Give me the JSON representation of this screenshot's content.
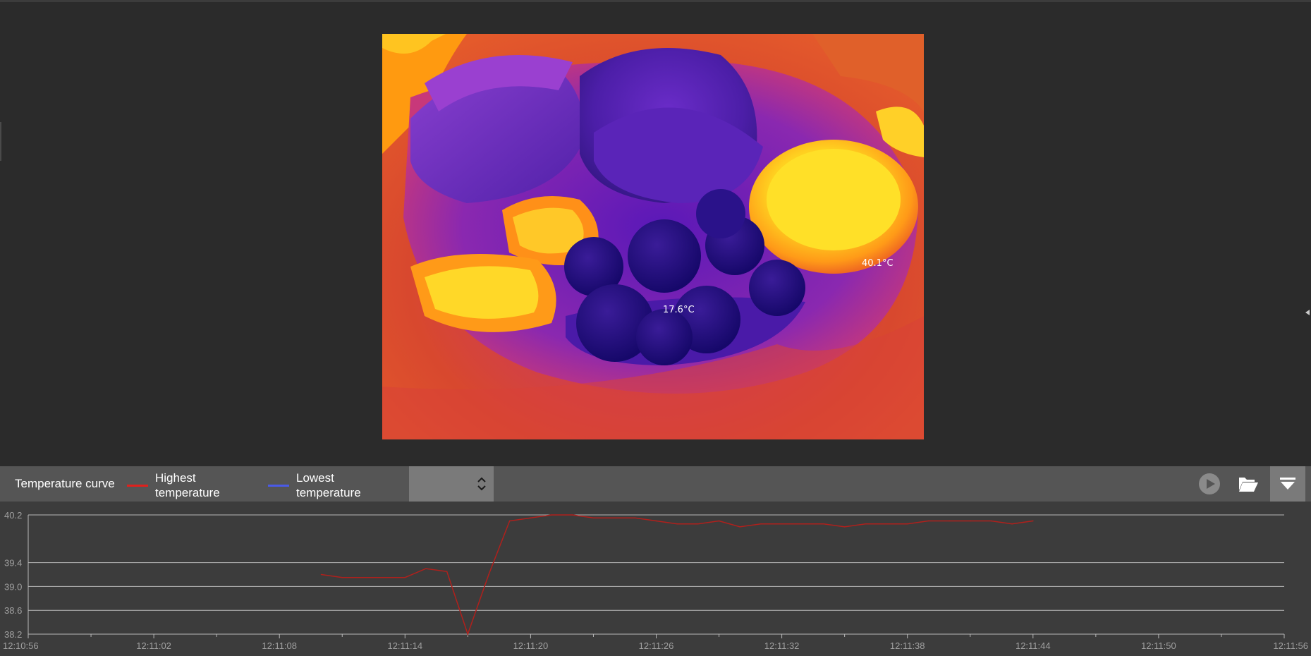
{
  "viewer": {
    "max_label": "40.1°C",
    "min_label": "17.6°C"
  },
  "toolbar": {
    "title": "Temperature curve",
    "legend": [
      {
        "label_line1": "Highest",
        "label_line2": "temperature",
        "color": "#e0201c"
      },
      {
        "label_line1": "Lowest",
        "label_line2": "temperature",
        "color": "#4a5ae8"
      }
    ],
    "combo_value": "",
    "buttons": [
      {
        "icon": "play-icon"
      },
      {
        "icon": "folder-open-icon"
      },
      {
        "icon": "collapse-panel-icon"
      }
    ]
  },
  "colors": {
    "highest_series": "#b0201c",
    "lowest_series": "#4a5ae8",
    "chart_bg": "#3c3c3c",
    "grid": "#b8b8b8",
    "axis_text": "#a0a0a0"
  },
  "chart_data": {
    "type": "line",
    "title": "",
    "xlabel": "",
    "ylabel": "",
    "ylim": [
      38.2,
      40.2
    ],
    "yticks": [
      "40.2",
      "39.4",
      "39.0",
      "38.6",
      "38.2"
    ],
    "ytick_values": [
      40.2,
      39.4,
      39.0,
      38.6,
      38.2
    ],
    "xlim_seconds": [
      0,
      60
    ],
    "xticks": [
      "12:10:56",
      "12:11:02",
      "12:11:08",
      "12:11:14",
      "12:11:20",
      "12:11:26",
      "12:11:32",
      "12:11:38",
      "12:11:44",
      "12:11:50",
      "12:11:56"
    ],
    "grid": true,
    "legend": "top-left",
    "series": [
      {
        "name": "Highest temperature",
        "x": [
          "12:11:10",
          "12:11:11",
          "12:11:12",
          "12:11:13",
          "12:11:14",
          "12:11:15",
          "12:11:16",
          "12:11:17",
          "12:11:18",
          "12:11:19",
          "12:11:20",
          "12:11:21",
          "12:11:22",
          "12:11:23",
          "12:11:24",
          "12:11:25",
          "12:11:26",
          "12:11:27",
          "12:11:28",
          "12:11:29",
          "12:11:30",
          "12:11:31",
          "12:11:32",
          "12:11:33",
          "12:11:34",
          "12:11:35",
          "12:11:36",
          "12:11:37",
          "12:11:38",
          "12:11:39",
          "12:11:40",
          "12:11:41",
          "12:11:42",
          "12:11:43",
          "12:11:44"
        ],
        "values": [
          39.2,
          39.15,
          39.15,
          39.15,
          39.15,
          39.3,
          39.25,
          38.2,
          39.2,
          40.1,
          40.15,
          40.2,
          40.2,
          40.15,
          40.15,
          40.15,
          40.1,
          40.05,
          40.05,
          40.1,
          40.0,
          40.05,
          40.05,
          40.05,
          40.05,
          40.0,
          40.05,
          40.05,
          40.05,
          40.1,
          40.1,
          40.1,
          40.1,
          40.05,
          40.1
        ]
      }
    ]
  }
}
